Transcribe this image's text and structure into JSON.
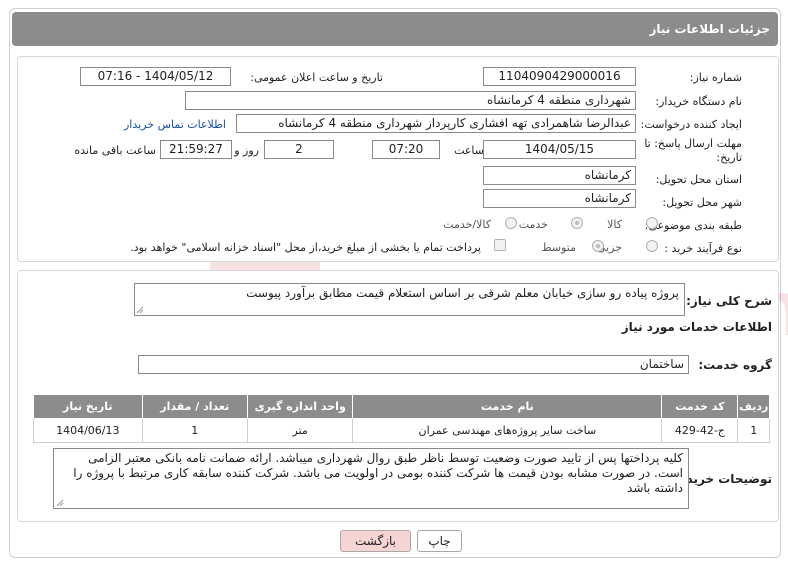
{
  "header": {
    "title": "جزئیات اطلاعات نیاز"
  },
  "form": {
    "need_number_label": "شماره نیاز:",
    "need_number": "1104090429000016",
    "announce_label": "تاریخ و ساعت اعلان عمومی:",
    "announce_value": "1404/05/12 - 07:16",
    "buyer_org_label": "نام دستگاه خریدار:",
    "buyer_org": "شهرداری منطقه 4 کرمانشاه",
    "creator_label": "ایجاد کننده درخواست:",
    "creator": "عبدالرضا شاهمرادی تهه افشاری کارپرداز شهرداری منطقه 4 کرمانشاه",
    "contact_link": "اطلاعات تماس خریدار",
    "deadline_label_1": "مهلت ارسال پاسخ: تا",
    "deadline_label_2": "تاریخ:",
    "deadline_date": "1404/05/15",
    "time_label": "ساعت",
    "deadline_time": "07:20",
    "days": "2",
    "days_label": "روز و",
    "remaining_time": "21:59:27",
    "remaining_label": "ساعت باقی مانده",
    "province_label": "استان محل تحویل:",
    "province": "کرمانشاه",
    "city_label": "شهر محل تحویل:",
    "city": "کرمانشاه",
    "category_label": "طبقه بندی موضوعی:",
    "category_options": [
      "کالا",
      "خدمت",
      "کالا/خدمت"
    ],
    "process_label": "نوع فرآیند خرید :",
    "process_options": [
      "جزیی",
      "متوسط"
    ],
    "payment_note": "پرداخت تمام یا بخشی از مبلغ خرید،از محل \"اسناد خزانه اسلامی\" خواهد بود."
  },
  "summary": {
    "label": "شرح کلی نیاز:",
    "text": "پروژه پیاده رو سازی خیابان معلم شرقی بر اساس استعلام قیمت مطابق برآورد پیوست"
  },
  "services": {
    "section_title": "اطلاعات خدمات مورد نیاز",
    "group_label": "گروه خدمت:",
    "group_value": "ساختمان",
    "columns": [
      "ردیف",
      "کد خدمت",
      "نام خدمت",
      "واحد اندازه گیری",
      "تعداد / مقدار",
      "تاریخ نیاز"
    ],
    "rows": [
      [
        "1",
        "ج-42-429",
        "ساخت سایر پروژه‌های مهندسی عمران",
        "متر",
        "1",
        "1404/06/13"
      ]
    ]
  },
  "notes": {
    "label": "توضیحات خریدار:",
    "text": "کلیه پرداختها پس از تایید صورت وضعیت توسط ناظر طبق روال شهرداری میباشد. ارائه ضمانت نامه بانکی معتبر الزامی است. در صورت مشابه بودن قیمت ها شرکت کننده بومی در اولویت می باشد. شرکت کننده سابقه کاری مرتبط با پروژه را داشته باشد"
  },
  "buttons": {
    "print": "چاپ",
    "back": "بازگشت"
  },
  "watermark": {
    "text": "AriaTender.neT"
  }
}
